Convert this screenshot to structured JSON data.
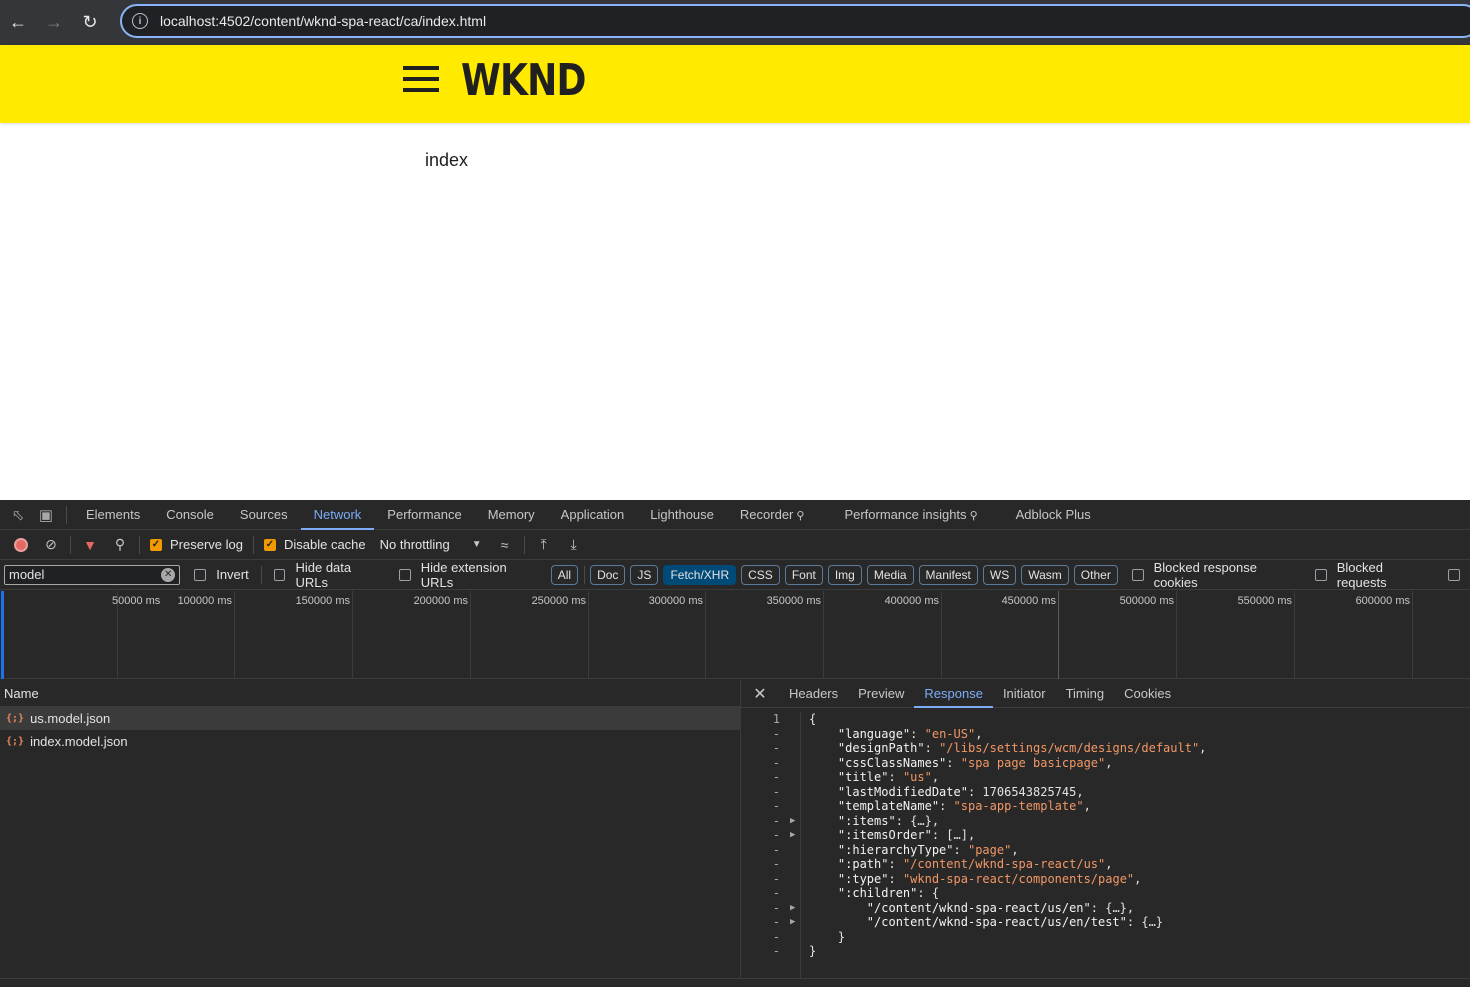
{
  "browser": {
    "url": "localhost:4502/content/wknd-spa-react/ca/index.html"
  },
  "page": {
    "logo": "WKND",
    "body_text": "index"
  },
  "devtools": {
    "tabs": [
      "Elements",
      "Console",
      "Sources",
      "Network",
      "Performance",
      "Memory",
      "Application",
      "Lighthouse",
      "Recorder",
      "Performance insights",
      "Adblock Plus"
    ],
    "active_tab": "Network",
    "toolbar": {
      "preserve_log": "Preserve log",
      "disable_cache": "Disable cache",
      "throttling": "No throttling"
    },
    "filter": {
      "value": "model",
      "invert": "Invert",
      "hide_data_urls": "Hide data URLs",
      "hide_extension_urls": "Hide extension URLs",
      "types": [
        "All",
        "Doc",
        "JS",
        "Fetch/XHR",
        "CSS",
        "Font",
        "Img",
        "Media",
        "Manifest",
        "WS",
        "Wasm",
        "Other"
      ],
      "active_type": "Fetch/XHR",
      "blocked_response_cookies": "Blocked response cookies",
      "blocked_requests": "Blocked requests"
    },
    "timeline_ticks": [
      "50000 ms",
      "100000 ms",
      "150000 ms",
      "200000 ms",
      "250000 ms",
      "300000 ms",
      "350000 ms",
      "400000 ms",
      "450000 ms",
      "500000 ms",
      "550000 ms",
      "600000 ms"
    ],
    "requests": {
      "column": "Name",
      "rows": [
        "us.model.json",
        "index.model.json"
      ]
    },
    "detail": {
      "tabs": [
        "Headers",
        "Preview",
        "Response",
        "Initiator",
        "Timing",
        "Cookies"
      ],
      "active_tab": "Response",
      "gutter": [
        "1",
        "-",
        "-",
        "-",
        "-",
        "-",
        "-",
        "-",
        "-",
        "-",
        "-",
        "-",
        "-",
        "-",
        "-",
        "-",
        "-"
      ],
      "lines": [
        "{",
        "    \"language\": \"en-US\",",
        "    \"designPath\": \"/libs/settings/wcm/designs/default\",",
        "    \"cssClassNames\": \"spa page basicpage\",",
        "    \"title\": \"us\",",
        "    \"lastModifiedDate\": 1706543825745,",
        "    \"templateName\": \"spa-app-template\",",
        "    \":items\": {…},",
        "    \":itemsOrder\": […],",
        "    \":hierarchyType\": \"page\",",
        "    \":path\": \"/content/wknd-spa-react/us\",",
        "    \":type\": \"wknd-spa-react/components/page\",",
        "    \":children\": {",
        "        \"/content/wknd-spa-react/us/en\": {…},",
        "        \"/content/wknd-spa-react/us/en/test\": {…}",
        "    }",
        "}"
      ]
    }
  }
}
